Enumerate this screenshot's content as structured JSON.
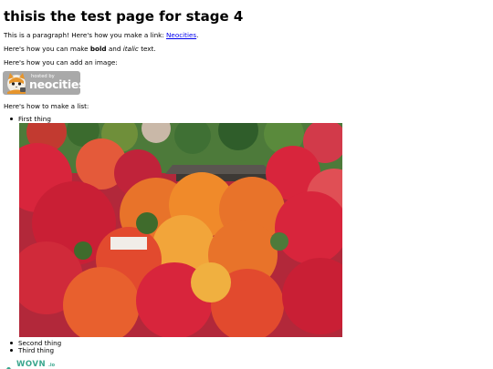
{
  "page": {
    "title": "thisis the test page for stage 4"
  },
  "paragraphs": {
    "link_intro": "This is a paragraph! Here's how you make a link:",
    "link_text": "Neocities",
    "link_end": ".",
    "format_intro": "Here's how you can make",
    "bold_word": "bold",
    "and_word": "and",
    "italic_word": "italic",
    "format_end": "text.",
    "image_intro": "Here's how you can add an image:",
    "list_intro": "Here's how to make a list:"
  },
  "badge": {
    "hosted_text": "hosted by",
    "brand_text": "neocities",
    "icon": "neocities-cat-icon"
  },
  "list": {
    "items": [
      "First thing",
      "Second thing",
      "Third thing"
    ]
  },
  "photo": {
    "subject": "autumn-maple-foliage-with-temple-roof",
    "colors": {
      "red": "#d8253c",
      "orange": "#e8732a",
      "green": "#3f6b2c",
      "roof": "#5a5550"
    }
  },
  "footer": {
    "logo_text": "WOVN",
    "logo_suffix": ".io",
    "logo_color": "#3aa68e",
    "icon": "wovn-logo-icon"
  }
}
